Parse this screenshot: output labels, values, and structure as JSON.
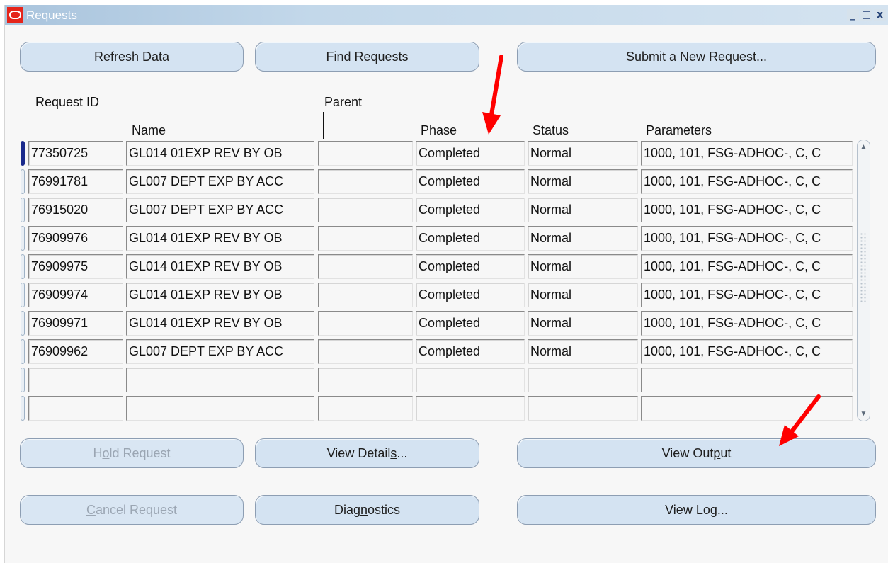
{
  "window": {
    "title": "Requests",
    "controls": [
      "_",
      "□",
      "x"
    ]
  },
  "top_buttons": {
    "refresh": {
      "pre": "",
      "mn": "R",
      "post": "efresh Data"
    },
    "find": {
      "pre": "Fi",
      "mn": "n",
      "post": "d Requests"
    },
    "submit": {
      "pre": "Sub",
      "mn": "m",
      "post": "it a New Request..."
    }
  },
  "columns": {
    "request_id": "Request ID",
    "name": "Name",
    "parent": "Parent",
    "phase": "Phase",
    "status": "Status",
    "parameters": "Parameters"
  },
  "rows": [
    {
      "request_id": "77350725",
      "name": "GL014 01EXP REV BY OB",
      "parent": "",
      "phase": "Completed",
      "status": "Normal",
      "parameters": "1000, 101, FSG-ADHOC-, C, C"
    },
    {
      "request_id": "76991781",
      "name": "GL007 DEPT EXP BY ACC",
      "parent": "",
      "phase": "Completed",
      "status": "Normal",
      "parameters": "1000, 101, FSG-ADHOC-, C, C"
    },
    {
      "request_id": "76915020",
      "name": "GL007 DEPT EXP BY ACC",
      "parent": "",
      "phase": "Completed",
      "status": "Normal",
      "parameters": "1000, 101, FSG-ADHOC-, C, C"
    },
    {
      "request_id": "76909976",
      "name": "GL014 01EXP REV BY OB",
      "parent": "",
      "phase": "Completed",
      "status": "Normal",
      "parameters": "1000, 101, FSG-ADHOC-, C, C"
    },
    {
      "request_id": "76909975",
      "name": "GL014 01EXP REV BY OB",
      "parent": "",
      "phase": "Completed",
      "status": "Normal",
      "parameters": "1000, 101, FSG-ADHOC-, C, C"
    },
    {
      "request_id": "76909974",
      "name": "GL014 01EXP REV BY OB",
      "parent": "",
      "phase": "Completed",
      "status": "Normal",
      "parameters": "1000, 101, FSG-ADHOC-, C, C"
    },
    {
      "request_id": "76909971",
      "name": "GL014 01EXP REV BY OB",
      "parent": "",
      "phase": "Completed",
      "status": "Normal",
      "parameters": "1000, 101, FSG-ADHOC-, C, C"
    },
    {
      "request_id": "76909962",
      "name": "GL007 DEPT EXP BY ACC",
      "parent": "",
      "phase": "Completed",
      "status": "Normal",
      "parameters": "1000, 101, FSG-ADHOC-, C, C"
    },
    {
      "request_id": "",
      "name": "",
      "parent": "",
      "phase": "",
      "status": "",
      "parameters": ""
    },
    {
      "request_id": "",
      "name": "",
      "parent": "",
      "phase": "",
      "status": "",
      "parameters": ""
    }
  ],
  "bottom_buttons": {
    "hold": {
      "pre": "H",
      "mn": "o",
      "post": "ld Request"
    },
    "view_details": {
      "pre": "View Detail",
      "mn": "s",
      "post": "..."
    },
    "view_output": {
      "pre": "View Out",
      "mn": "p",
      "post": "ut"
    },
    "cancel": {
      "pre": "",
      "mn": "C",
      "post": "ancel Request"
    },
    "diagnostics": {
      "pre": "Diag",
      "mn": "n",
      "post": "ostics"
    },
    "view_log": {
      "pre": "View Log...",
      "mn": "",
      "post": ""
    }
  },
  "icons": {
    "app": "oracle-logo-icon",
    "scroll_up": "▲",
    "scroll_down": "▼",
    "annotation_arrow": "red-arrow-icon"
  },
  "colors": {
    "active_row_indicator": "#1a2a8c",
    "annotation_arrow": "#ff0000",
    "button_fill": "#d4e3f2",
    "title_bar": "#c3d8ea"
  }
}
